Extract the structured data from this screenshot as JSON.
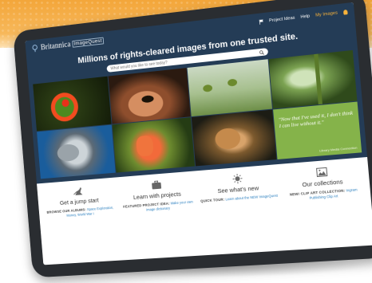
{
  "header": {
    "brand": "Britannica",
    "product": "ImageQuest",
    "nav": [
      {
        "label": "Project Ideas"
      },
      {
        "label": "Help"
      },
      {
        "label": "My Images"
      }
    ]
  },
  "hero": {
    "title": "Millions of rights-cleared images from one trusted site.",
    "search_placeholder": "What would you like to see today?"
  },
  "gallery": {
    "quote": "\"Now that I've used it, I don't think I can live without it.\"",
    "quote_source": "Library Media Connection"
  },
  "features": [
    {
      "title": "Get a jump start",
      "caption": "BROWSE OUR ALBUMS:",
      "link": "Space Exploration, Money, World War I",
      "icon": "kangaroo-icon"
    },
    {
      "title": "Learn with projects",
      "caption": "FEATURED PROJECT IDEA:",
      "link": "Make your own image dictionary",
      "icon": "briefcase-icon"
    },
    {
      "title": "See what's new",
      "caption": "QUICK TOUR:",
      "link": "Learn about the NEW ImageQuest",
      "icon": "sun-icon"
    },
    {
      "title": "Our collections",
      "caption": "NEW! CLIP ART COLLECTION:",
      "link": "Ingram Publishing Clip Art",
      "icon": "image-icon"
    }
  ],
  "colors": {
    "navy": "#243c56",
    "orange": "#f3a63a",
    "green": "#85b34a",
    "link": "#2a7fbf"
  }
}
